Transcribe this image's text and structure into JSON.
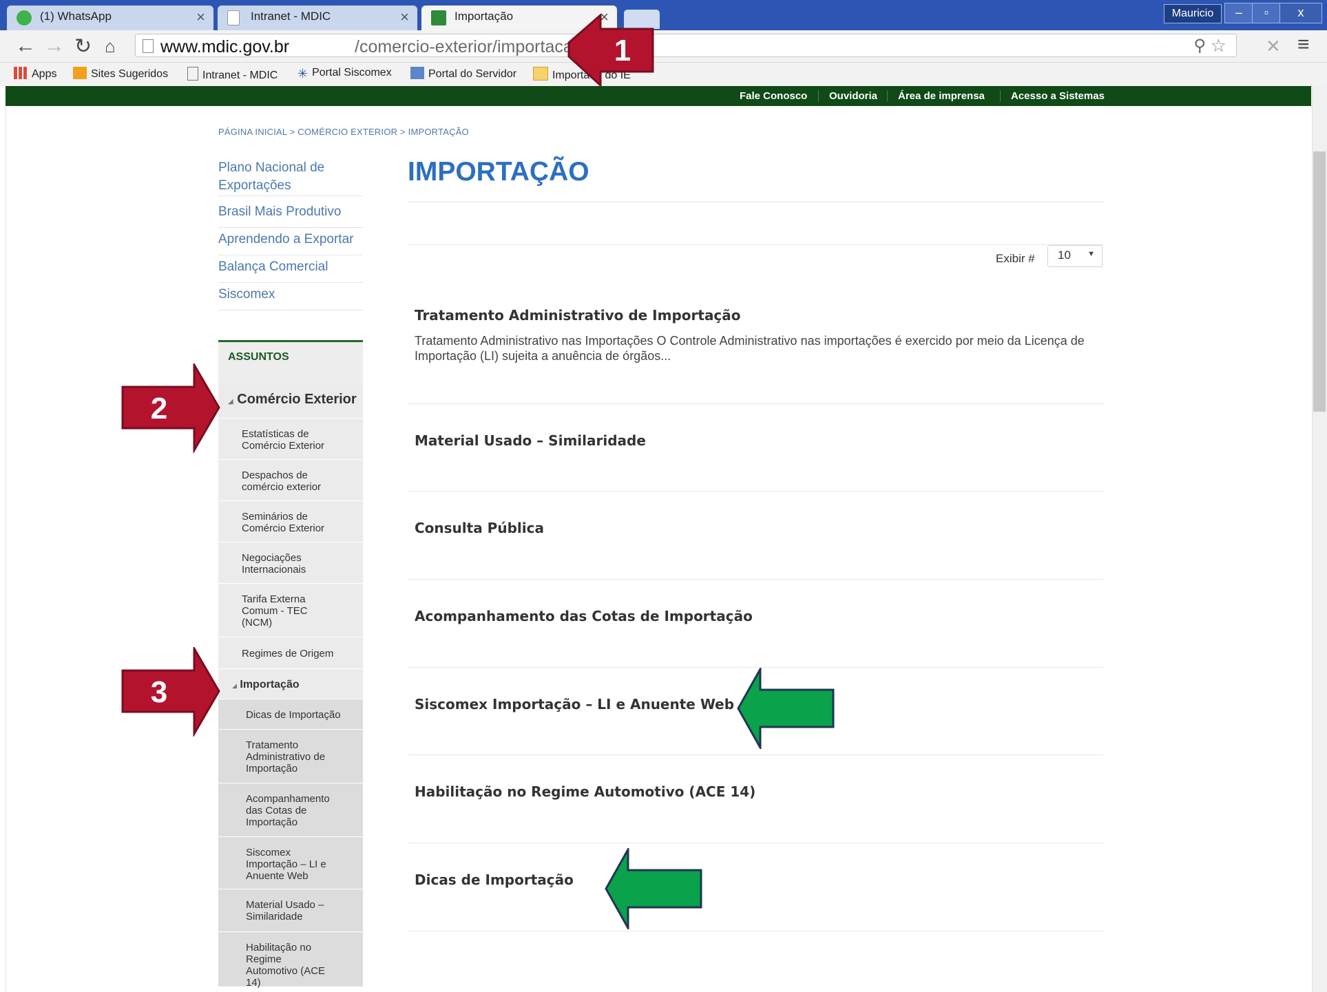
{
  "browser": {
    "tabs": [
      {
        "label": "(1) WhatsApp"
      },
      {
        "label": "Intranet - MDIC"
      },
      {
        "label": "Importação"
      }
    ],
    "user": "Mauricio",
    "url_host": "www.mdic.gov.br",
    "url_path": "/comercio-exterior/importacao",
    "bookmarks": [
      "Apps",
      "Sites Sugeridos",
      "Intranet - MDIC",
      "Portal Siscomex",
      "Portal do Servidor",
      "Importado do IE"
    ]
  },
  "topbar": {
    "links": [
      "Fale Conosco",
      "Ouvidoria",
      "Área de imprensa",
      "Acesso a Sistemas"
    ]
  },
  "breadcrumb": "PÁGINA INICIAL > COMÉRCIO EXTERIOR > IMPORTAÇÃO",
  "sidebar": {
    "top_links": [
      "Plano Nacional de Exportações",
      "Brasil Mais Produtivo",
      "Aprendendo a Exportar",
      "Balança Comercial",
      "Siscomex"
    ],
    "assuntos_heading": "ASSUNTOS",
    "section": "Comércio Exterior",
    "items": [
      "Estatísticas de Comércio Exterior",
      "Despachos de comércio exterior",
      "Seminários de Comércio Exterior",
      "Negociações Internacionais",
      "Tarifa Externa Comum - TEC (NCM)",
      "Regimes de Origem"
    ],
    "subsection": "Importação",
    "subitems": [
      "Dicas de Importação",
      "Tratamento Administrativo de Importação",
      "Acompanhamento das Cotas de Importação",
      "Siscomex Importação – LI e Anuente Web",
      "Material Usado – Similaridade",
      "Habilitação no Regime Automotivo (ACE 14)"
    ]
  },
  "main": {
    "title": "IMPORTAÇÃO",
    "exibir_label": "Exibir #",
    "exibir_value": "10",
    "articles": [
      {
        "title": "Tratamento Administrativo de Importação",
        "desc": "Tratamento Administrativo nas Importações   O Controle Administrativo nas importações é exercido por meio da Licença de Importação (LI) sujeita a anuência de órgãos..."
      },
      {
        "title": "Material Usado – Similaridade"
      },
      {
        "title": "Consulta Pública"
      },
      {
        "title": "Acompanhamento das Cotas de Importação"
      },
      {
        "title": "Siscomex Importação – LI e Anuente Web"
      },
      {
        "title": "Habilitação no Regime Automotivo (ACE 14)"
      },
      {
        "title": "Dicas de Importação"
      }
    ]
  },
  "annotations": {
    "callout_1": "1",
    "callout_2": "2",
    "callout_3": "3"
  }
}
